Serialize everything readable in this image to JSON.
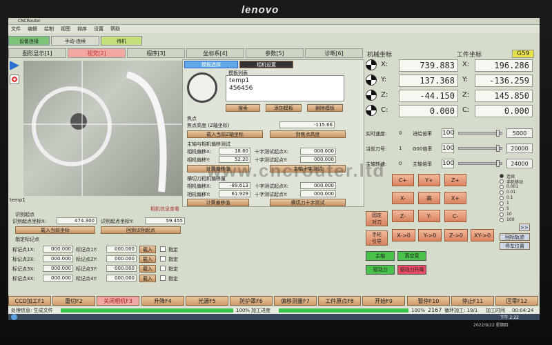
{
  "monitor": {
    "brand": "lenovo"
  },
  "window": {
    "title": "CNCRouter"
  },
  "menu": [
    "文件",
    "编辑",
    "绘制",
    "视图",
    "排序",
    "设置",
    "帮助"
  ],
  "modes": [
    {
      "label": "设备连接",
      "color": "#7cc47a"
    },
    {
      "label": "手动-连续",
      "color": "#d7dccf"
    },
    {
      "label": "待机",
      "color": "#c3e07a"
    }
  ],
  "tabs": [
    "图形显示[1]",
    "视觉[2]",
    "程序[3]",
    "坐标系[4]",
    "参数[5]",
    "诊断[6]"
  ],
  "camera": {
    "label": "temp1",
    "offset_title": "识别起点",
    "marked_x_label": "识别起点坐标X:",
    "marked_x": "474.300",
    "marked_y_label": "识别起点坐标Y:",
    "marked_y": "59.455",
    "info_button": "相机信息查看",
    "load_btn": "载入当前坐标",
    "back_btn": "回到识别起点",
    "mark_title": "指定标记点",
    "marks": [
      {
        "xl": "标记点1X:",
        "x": "000.000",
        "yl": "标记点1Y:",
        "y": "000.000",
        "load": "载入",
        "fix": "指定"
      },
      {
        "xl": "标记点2X:",
        "x": "000.000",
        "yl": "标记点2Y:",
        "y": "000.000",
        "load": "载入",
        "fix": "指定"
      },
      {
        "xl": "标记点3X:",
        "x": "000.000",
        "yl": "标记点3Y:",
        "y": "000.000",
        "load": "载入",
        "fix": "指定"
      },
      {
        "xl": "标记点4X:",
        "x": "000.000",
        "yl": "标记点4Y:",
        "y": "000.000",
        "load": "载入",
        "fix": "指定"
      }
    ]
  },
  "template": {
    "tab_select": "模板选择",
    "tab_camera": "相机设置",
    "list_title": "模板列表",
    "list_items": [
      "temp1",
      "456456"
    ],
    "search_btn": "搜索",
    "add_btn": "添加模板",
    "del_btn": "删除模板",
    "focus_title": "焦点",
    "focus_label": "焦点高度 (Z轴坐标)",
    "focus_value": "-115.66",
    "focus_load": "载入当前Z轴坐标",
    "focus_move": "到焦点高度",
    "spindle_title": "主轴与相机偏移测试",
    "spindle_x_label": "相机偏移X:",
    "spindle_x": "18.60",
    "spindle_y_label": "相机偏移Y:",
    "spindle_y": "52.20",
    "cross_x_label": "十字测试起点X:",
    "cross_x": "000.000",
    "cross_y_label": "十字测试起点Y:",
    "cross_y": "000.000",
    "calc_btn": "计算偏移值",
    "spindle_test": "主轴十字测试",
    "knife_title": "横切刀相机偏移量",
    "knife_x_label": "相机偏移X:",
    "knife_x": "-89.613",
    "knife_y_label": "相机偏移Y:",
    "knife_y": "61.929",
    "kcross_x_label": "十字测试起点X:",
    "kcross_x": "000.000",
    "kcross_y_label": "十字测试起点Y:",
    "kcross_y": "000.000",
    "kcalc_btn": "计算偏移值",
    "knife_test": "横切刀十字测试"
  },
  "coords": {
    "machine_title": "机械坐标",
    "work_title": "工件坐标",
    "wcs": "G59",
    "axes": [
      {
        "name": "X:",
        "machine": "739.883",
        "work": "196.286"
      },
      {
        "name": "Y:",
        "machine": "137.368",
        "work": "-136.259"
      },
      {
        "name": "Z:",
        "machine": "-44.150",
        "work": "145.850"
      },
      {
        "name": "C:",
        "machine": "0.000",
        "work": "0.000"
      }
    ]
  },
  "feeds": [
    {
      "label": "实时速度:",
      "value": "0",
      "label2": "进给倍率",
      "pct": "100",
      "set": "5000",
      "fill": 0.9
    },
    {
      "label": "当前刀号:",
      "value": "1",
      "label2": "G00倍率",
      "pct": "100",
      "set": "20000",
      "fill": 0.9
    },
    {
      "label": "主轴转速:",
      "value": "0",
      "label2": "主轴倍率",
      "pct": "100",
      "set": "24000",
      "fill": 0.9
    }
  ],
  "jog": {
    "row1": [
      "C+",
      "Y+",
      "Z+"
    ],
    "row2": [
      "X-",
      "高",
      "X+"
    ],
    "row3": [
      "Z-",
      "Y-",
      "C-"
    ],
    "row4": [
      "X->0",
      "Y->0",
      "Z->0",
      "XY->0"
    ],
    "fixed": "固定\n对刀",
    "hand": "手轮\n引导",
    "modes": [
      "连续",
      "手轮移动",
      "0.001",
      "0.01",
      "0.1",
      "1",
      "5",
      "10",
      "100"
    ],
    "more": ">>",
    "goto_target": "回标轨迹",
    "goto_park": "停车位置"
  },
  "toggles": [
    {
      "label": "主轴",
      "color": "#48c24a"
    },
    {
      "label": "真空泵",
      "color": "#48c24a"
    },
    {
      "label": "驱动刀",
      "color": "#48c24a"
    },
    {
      "label": "驱动刀升降",
      "color": "#ee4d63"
    }
  ],
  "fkeys": [
    "CCD加工F1",
    "重切F2",
    "关闭相机F3",
    "升降F4",
    "光源F5",
    "防护罩F6",
    "偏移测量F7",
    "工件原点F8",
    "开始F9",
    "暂停F10",
    "停止F11",
    "回零F12"
  ],
  "status": {
    "left": "处理信息: 生成文件",
    "progress1": "100%",
    "progress_label": "加工进度",
    "progress2": "100%",
    "line_count": "2167",
    "loop": "循环加工: 19/1",
    "time_label": "加工时间",
    "time": "00:04:24"
  },
  "taskbar": {
    "time": "下午 2:22",
    "date": "2022/9/22 星期四"
  },
  "watermark": "www.cncrouter.ltd"
}
